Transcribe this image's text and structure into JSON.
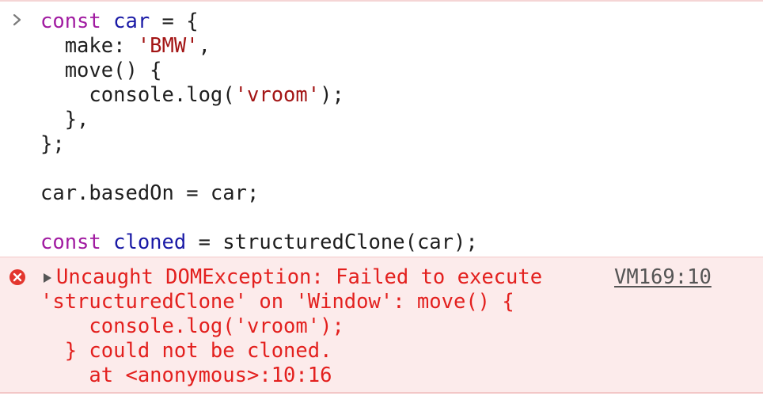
{
  "input": {
    "lines": [
      [
        "const",
        " ",
        "car",
        " = {"
      ],
      [
        "  make: ",
        "'BMW'",
        ","
      ],
      [
        "  move() {"
      ],
      [
        "    console.log(",
        "'vroom'",
        ");"
      ],
      [
        "  },"
      ],
      [
        "};"
      ],
      [
        ""
      ],
      [
        "car.basedOn = car;"
      ],
      [
        ""
      ],
      [
        "const",
        " ",
        "cloned",
        " = structuredClone(car);"
      ]
    ]
  },
  "error": {
    "lines": [
      "Uncaught DOMException: Failed to execute",
      "'structuredClone' on 'Window': move() {",
      "    console.log('vroom');",
      "  } could not be cloned.",
      "    at <anonymous>:10:16"
    ],
    "source": "VM169:10"
  },
  "colors": {
    "keyword": "#a11ba1",
    "variable": "#1a1aa6",
    "string": "#a31515",
    "error_text": "#e3201e",
    "error_bg": "#fcebeb"
  },
  "icons": {
    "prompt": "chevron-right-icon",
    "error": "error-circle-x-icon",
    "expand": "triangle-right-icon"
  }
}
